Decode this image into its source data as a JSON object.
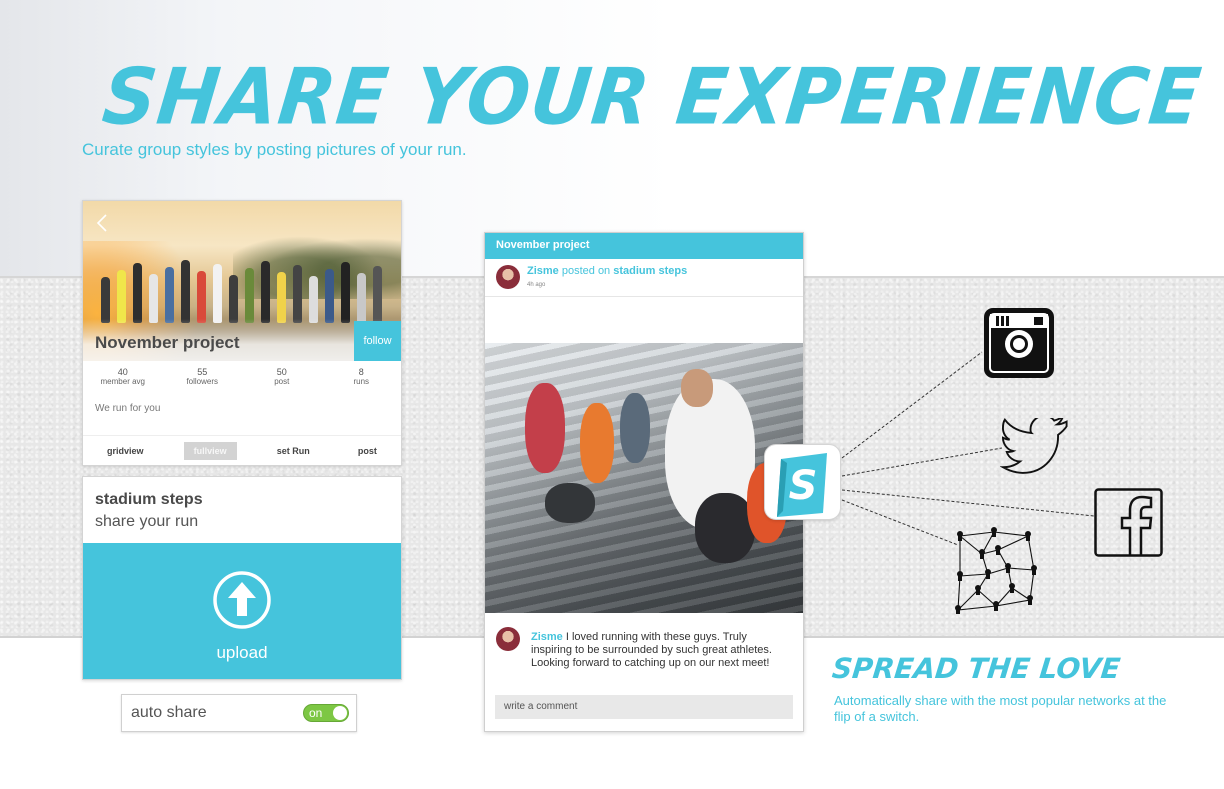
{
  "headline": "SHARE YOUR EXPERIENCE",
  "subheadline": "Curate group styles by posting pictures of your run.",
  "group_card": {
    "name": "November project",
    "follow_label": "follow",
    "stats": [
      {
        "value": "40",
        "label": "member avg"
      },
      {
        "value": "55",
        "label": "followers"
      },
      {
        "value": "50",
        "label": "post"
      },
      {
        "value": "8",
        "label": "runs"
      }
    ],
    "tagline": "We run for you",
    "tabs": [
      {
        "label": "gridview",
        "active": false
      },
      {
        "label": "fullview",
        "active": true
      },
      {
        "label": "set Run",
        "active": false
      },
      {
        "label": "post",
        "active": false
      }
    ]
  },
  "upload_card": {
    "title": "stadium steps",
    "subtitle": "share your run",
    "upload_label": "upload"
  },
  "auto_share": {
    "label": "auto share",
    "toggle_label": "on",
    "enabled": true
  },
  "post_card": {
    "group": "November project",
    "author": "Zisme",
    "action": "posted on",
    "location": "stadium steps",
    "time": "4h ago",
    "comment_author": "Zisme",
    "comment_text": "I loved running with these guys. Truly inspiring to be surrounded by such great athletes. Looking forward to catching up on our next meet!",
    "comment_placeholder": "write a comment"
  },
  "app_badge_letter": "S",
  "social_networks": [
    "instagram-icon",
    "twitter-icon",
    "facebook-icon",
    "network-icon"
  ],
  "spread": {
    "title": "SPREAD THE LOVE",
    "subtitle": "Automatically share with the most popular networks at the flip of a switch."
  },
  "colors": {
    "accent": "#45c4dc",
    "toggle_on": "#7dc744",
    "paper": "#e7e7e7"
  }
}
